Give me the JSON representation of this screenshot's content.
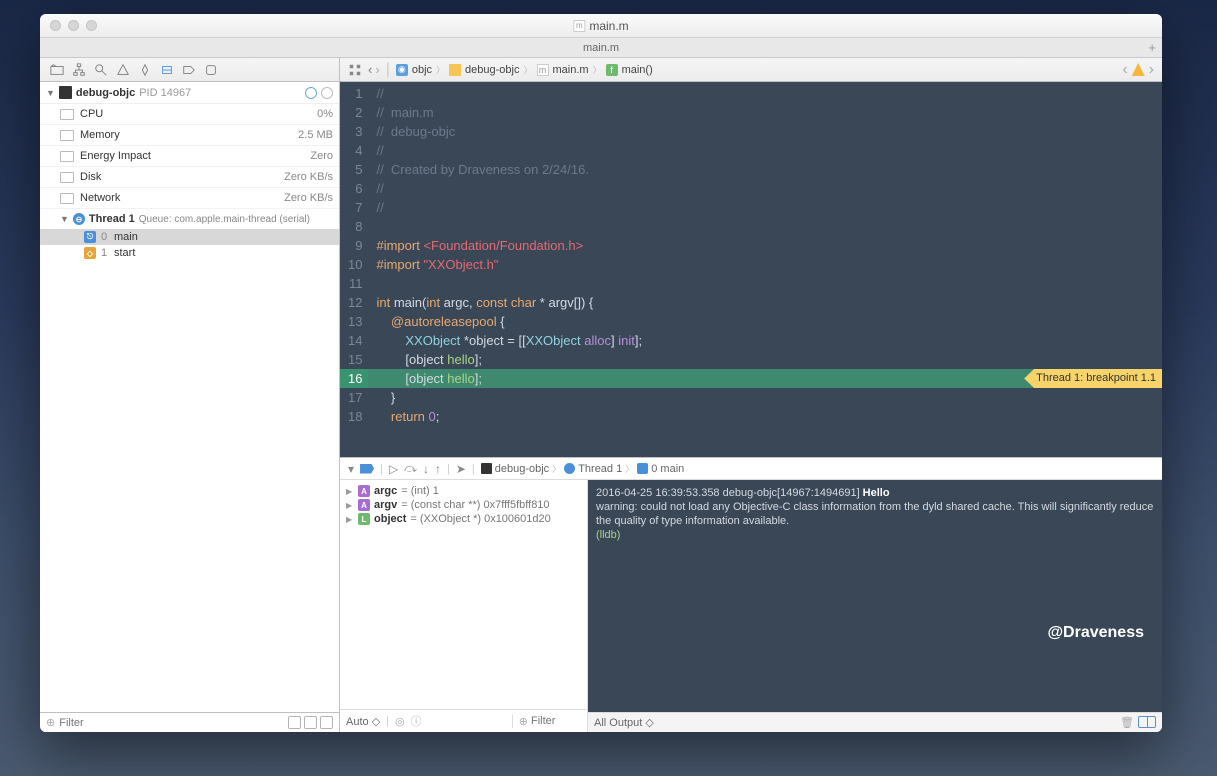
{
  "window": {
    "title": "main.m",
    "tab": "main.m"
  },
  "breadcrumb": {
    "items": [
      "objc",
      "debug-objc",
      "main.m",
      "main()"
    ]
  },
  "sidebar": {
    "target": "debug-objc",
    "pid_label": "PID 14967",
    "gauges": [
      {
        "label": "CPU",
        "value": "0%"
      },
      {
        "label": "Memory",
        "value": "2.5 MB"
      },
      {
        "label": "Energy Impact",
        "value": "Zero"
      },
      {
        "label": "Disk",
        "value": "Zero KB/s"
      },
      {
        "label": "Network",
        "value": "Zero KB/s"
      }
    ],
    "thread": {
      "label": "Thread 1",
      "queue": "Queue: com.apple.main-thread (serial)"
    },
    "frames": [
      {
        "index": "0",
        "name": "main"
      },
      {
        "index": "1",
        "name": "start"
      }
    ],
    "filter_placeholder": "Filter"
  },
  "code": {
    "lines": [
      {
        "n": 1,
        "seg": [
          {
            "t": "//",
            "c": "c-comment"
          }
        ]
      },
      {
        "n": 2,
        "seg": [
          {
            "t": "//  main.m",
            "c": "c-comment"
          }
        ]
      },
      {
        "n": 3,
        "seg": [
          {
            "t": "//  debug-objc",
            "c": "c-comment"
          }
        ]
      },
      {
        "n": 4,
        "seg": [
          {
            "t": "//",
            "c": "c-comment"
          }
        ]
      },
      {
        "n": 5,
        "seg": [
          {
            "t": "//  Created by Draveness on 2/24/16.",
            "c": "c-comment"
          }
        ]
      },
      {
        "n": 6,
        "seg": [
          {
            "t": "//",
            "c": "c-comment"
          }
        ]
      },
      {
        "n": 7,
        "seg": [
          {
            "t": "//",
            "c": "c-comment"
          }
        ]
      },
      {
        "n": 8,
        "seg": [
          {
            "t": "",
            "c": ""
          }
        ]
      },
      {
        "n": 9,
        "seg": [
          {
            "t": "#import ",
            "c": "c-pre"
          },
          {
            "t": "<Foundation/Foundation.h>",
            "c": "c-str"
          }
        ]
      },
      {
        "n": 10,
        "seg": [
          {
            "t": "#import ",
            "c": "c-pre"
          },
          {
            "t": "\"XXObject.h\"",
            "c": "c-str"
          }
        ]
      },
      {
        "n": 11,
        "seg": [
          {
            "t": "",
            "c": ""
          }
        ]
      },
      {
        "n": 12,
        "seg": [
          {
            "t": "int",
            "c": "c-kw"
          },
          {
            "t": " main(",
            "c": ""
          },
          {
            "t": "int",
            "c": "c-kw"
          },
          {
            "t": " argc, ",
            "c": ""
          },
          {
            "t": "const",
            "c": "c-kw"
          },
          {
            "t": " ",
            "c": ""
          },
          {
            "t": "char",
            "c": "c-kw"
          },
          {
            "t": " * argv[]) {",
            "c": ""
          }
        ]
      },
      {
        "n": 13,
        "seg": [
          {
            "t": "    ",
            "c": ""
          },
          {
            "t": "@autoreleasepool",
            "c": "c-kw"
          },
          {
            "t": " {",
            "c": ""
          }
        ]
      },
      {
        "n": 14,
        "seg": [
          {
            "t": "        ",
            "c": ""
          },
          {
            "t": "XXObject",
            "c": "c-type"
          },
          {
            "t": " *object = [[",
            "c": ""
          },
          {
            "t": "XXObject",
            "c": "c-type"
          },
          {
            "t": " ",
            "c": ""
          },
          {
            "t": "alloc",
            "c": "c-sel"
          },
          {
            "t": "] ",
            "c": ""
          },
          {
            "t": "init",
            "c": "c-sel"
          },
          {
            "t": "];",
            "c": ""
          }
        ]
      },
      {
        "n": 15,
        "seg": [
          {
            "t": "        [object ",
            "c": ""
          },
          {
            "t": "hello",
            "c": "c-func"
          },
          {
            "t": "];",
            "c": ""
          }
        ]
      },
      {
        "n": 16,
        "bp": true,
        "seg": [
          {
            "t": "        [object ",
            "c": ""
          },
          {
            "t": "hello",
            "c": "c-func"
          },
          {
            "t": "];",
            "c": ""
          }
        ]
      },
      {
        "n": 17,
        "seg": [
          {
            "t": "    }",
            "c": ""
          }
        ]
      },
      {
        "n": 18,
        "seg": [
          {
            "t": "    ",
            "c": ""
          },
          {
            "t": "return",
            "c": "c-kw"
          },
          {
            "t": " ",
            "c": ""
          },
          {
            "t": "0",
            "c": "c-sel"
          },
          {
            "t": ";",
            "c": ""
          }
        ]
      }
    ],
    "breakpoint_label": "Thread 1: breakpoint 1.1"
  },
  "debug_bar": {
    "target": "debug-objc",
    "thread": "Thread 1",
    "frame": "0 main"
  },
  "variables": [
    {
      "badge": "A",
      "name": "argc",
      "value": "= (int) 1"
    },
    {
      "badge": "A",
      "name": "argv",
      "value": "= (const char **) 0x7fff5fbff810"
    },
    {
      "badge": "L",
      "name": "object",
      "value": "= (XXObject *) 0x100601d20"
    }
  ],
  "vars_bottom": {
    "mode": "Auto",
    "filter_placeholder": "Filter"
  },
  "console": {
    "timestamp": "2016-04-25 16:39:53.358 debug-objc[14967:1494691]",
    "hello": " Hello",
    "warning": "warning: could not load any Objective-C class information from the dyld shared cache. This will significantly reduce the quality of type information available.",
    "prompt": "(lldb)",
    "watermark": "@Draveness",
    "mode": "All Output"
  }
}
